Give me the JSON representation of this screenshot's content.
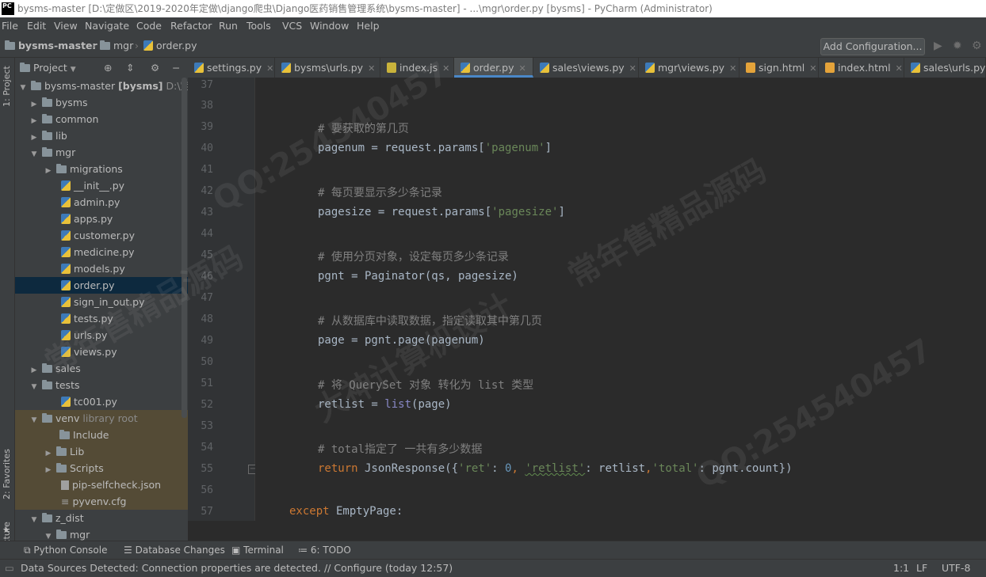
{
  "window": {
    "title": "bysms-master [D:\\定做区\\2019-2020年定做\\django爬虫\\Django医药销售管理系统\\bysms-master] - ...\\mgr\\order.py [bysms] - PyCharm (Administrator)",
    "app_icon": "PC"
  },
  "menu": [
    "File",
    "Edit",
    "View",
    "Navigate",
    "Code",
    "Refactor",
    "Run",
    "Tools",
    "VCS",
    "Window",
    "Help"
  ],
  "breadcrumb": [
    "bysms-master",
    "mgr",
    "order.py"
  ],
  "run_config_label": "Add Configuration...",
  "side_tools": {
    "project": "1: Project",
    "favorites": "2: Favorites",
    "structure": "Z: Structure"
  },
  "project_panel": {
    "title": "Project"
  },
  "tree": [
    {
      "label": "bysms-master",
      "bold_suffix": "[bysms]",
      "path": "D:\\定做",
      "type": "folder",
      "expanded": true
    },
    {
      "label": "bysms",
      "type": "folder",
      "expanded": false
    },
    {
      "label": "common",
      "type": "folder",
      "expanded": false
    },
    {
      "label": "lib",
      "type": "folder",
      "expanded": false
    },
    {
      "label": "mgr",
      "type": "folder",
      "expanded": true
    },
    {
      "label": "migrations",
      "type": "folder",
      "expanded": false
    },
    {
      "label": "__init__.py",
      "type": "py"
    },
    {
      "label": "admin.py",
      "type": "py"
    },
    {
      "label": "apps.py",
      "type": "py"
    },
    {
      "label": "customer.py",
      "type": "py"
    },
    {
      "label": "medicine.py",
      "type": "py"
    },
    {
      "label": "models.py",
      "type": "py"
    },
    {
      "label": "order.py",
      "type": "py",
      "selected": true
    },
    {
      "label": "sign_in_out.py",
      "type": "py"
    },
    {
      "label": "tests.py",
      "type": "py"
    },
    {
      "label": "urls.py",
      "type": "py"
    },
    {
      "label": "views.py",
      "type": "py"
    },
    {
      "label": "sales",
      "type": "folder",
      "expanded": false
    },
    {
      "label": "tests",
      "type": "folder",
      "expanded": true
    },
    {
      "label": "tc001.py",
      "type": "py"
    },
    {
      "label": "venv",
      "suffix": "library root",
      "type": "folder",
      "expanded": true
    },
    {
      "label": "Include",
      "type": "folder"
    },
    {
      "label": "Lib",
      "type": "folder",
      "expanded": false
    },
    {
      "label": "Scripts",
      "type": "folder",
      "expanded": false
    },
    {
      "label": "pip-selfcheck.json",
      "type": "file"
    },
    {
      "label": "pyvenv.cfg",
      "type": "file"
    },
    {
      "label": "z_dist",
      "type": "folder",
      "expanded": true
    },
    {
      "label": "mgr",
      "type": "folder",
      "expanded": true
    }
  ],
  "tabs": [
    {
      "label": "settings.py",
      "icon": "py"
    },
    {
      "label": "bysms\\urls.py",
      "icon": "py"
    },
    {
      "label": "index.js",
      "icon": "js"
    },
    {
      "label": "order.py",
      "icon": "py",
      "active": true
    },
    {
      "label": "sales\\views.py",
      "icon": "py"
    },
    {
      "label": "mgr\\views.py",
      "icon": "py"
    },
    {
      "label": "sign.html",
      "icon": "html"
    },
    {
      "label": "index.html",
      "icon": "html"
    },
    {
      "label": "sales\\urls.py",
      "icon": "py"
    }
  ],
  "editor": {
    "line_numbers": [
      "37",
      "38",
      "39",
      "40",
      "41",
      "42",
      "43",
      "44",
      "45",
      "46",
      "47",
      "48",
      "49",
      "50",
      "51",
      "52",
      "53",
      "54",
      "55",
      "56",
      "57"
    ],
    "code": {
      "l39": "# 要获取的第几页",
      "l40_a": "pagenum = request.params[",
      "l40_s": "'pagenum'",
      "l40_b": "]",
      "l42": "# 每页要显示多少条记录",
      "l43_a": "pagesize = request.params[",
      "l43_s": "'pagesize'",
      "l43_b": "]",
      "l45": "# 使用分页对象，设定每页多少条记录",
      "l46": "pgnt = Paginator(qs, pagesize)",
      "l48": "# 从数据库中读取数据，指定读取其中第几页",
      "l49": "page = pgnt.page(pagenum)",
      "l51": "# 将 QuerySet 对象 转化为 list 类型",
      "l52_a": "retlist = ",
      "l52_k": "list",
      "l52_b": "(page)",
      "l54": "# total指定了 一共有多少数据",
      "l55_kw": "return",
      "l55_a": " JsonResponse({",
      "l55_s1": "'ret'",
      "l55_c1": ": ",
      "l55_n": "0",
      "l55_c2": ", ",
      "l55_s2": "'retlist'",
      "l55_c3": ": retlist",
      "l55_c4": ",",
      "l55_s3": "'total'",
      "l55_c5": ": pgnt.count})",
      "l57_kw": "except",
      "l57_a": " EmptyPage:"
    }
  },
  "bottom_tools": [
    "Python Console",
    "Database Changes",
    "Terminal",
    "6: TODO"
  ],
  "status": {
    "message": "Data Sources Detected: Connection properties are detected. // Configure (today 12:57)",
    "position": "1:1",
    "line_sep": "LF",
    "encoding": "UTF-8"
  },
  "watermarks": [
    "QQ:25454 0457",
    "常年售精品源码",
    "大神计算机设计",
    "QQ:254540457"
  ],
  "colors": {
    "background": "#2b2b2b",
    "panel": "#3c3f41",
    "selection": "#0d293e",
    "comment": "#808080",
    "string": "#6a8759",
    "keyword": "#cc7832",
    "number": "#6897bb"
  }
}
